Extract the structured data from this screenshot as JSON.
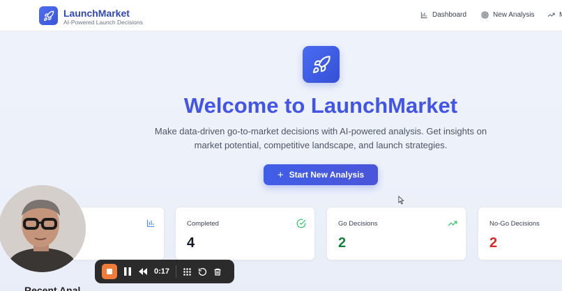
{
  "header": {
    "brand_name": "LaunchMarket",
    "brand_tagline": "AI-Powered Launch Decisions",
    "nav": [
      {
        "label": "Dashboard",
        "icon": "bar-chart-icon"
      },
      {
        "label": "New Analysis",
        "icon": "target-icon"
      },
      {
        "label": "M",
        "icon": "trending-up-icon"
      }
    ]
  },
  "hero": {
    "title": "Welcome to LaunchMarket",
    "subtitle_line1": "Make data-driven go-to-market decisions with AI-powered analysis. Get insights on",
    "subtitle_line2": "market potential, competitive landscape, and launch strategies.",
    "cta_label": "Start New Analysis"
  },
  "stats": [
    {
      "label": "",
      "value": "",
      "icon": "bar-chart-icon",
      "value_color": "#111827"
    },
    {
      "label": "Completed",
      "value": "4",
      "icon": "check-circle-icon",
      "value_color": "#111827"
    },
    {
      "label": "Go Decisions",
      "value": "2",
      "icon": "trending-up-icon",
      "value_color": "#15803d"
    },
    {
      "label": "No-Go Decisions",
      "value": "2",
      "icon": "",
      "value_color": "#dc2626"
    }
  ],
  "recorder": {
    "time": "0:17"
  },
  "bottom_text": "Recent Anal",
  "colors": {
    "brand": "#4255e8",
    "success": "#22c55e",
    "danger": "#dc2626",
    "recorder_stop": "#f07c3a"
  }
}
